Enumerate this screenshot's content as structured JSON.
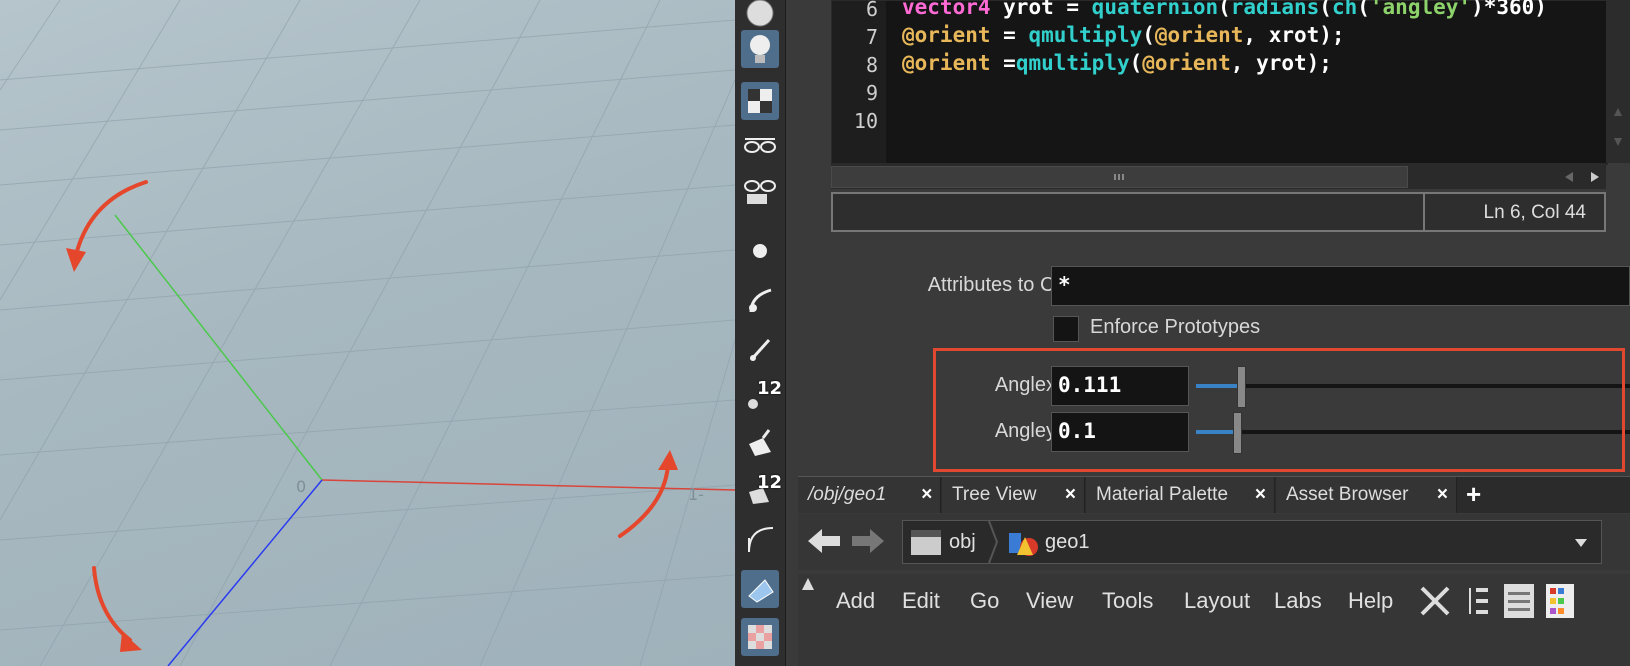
{
  "code": {
    "line_numbers": [
      "6",
      "7",
      "8",
      "9",
      "10"
    ],
    "lines": [
      [
        {
          "t": "vector4",
          "c": "kw-type"
        },
        {
          "t": " yrot = ",
          "c": "kw-plain"
        },
        {
          "t": "quaternion",
          "c": "kw-fn"
        },
        {
          "t": "(",
          "c": "kw-plain"
        },
        {
          "t": "radians",
          "c": "kw-fn"
        },
        {
          "t": "(",
          "c": "kw-plain"
        },
        {
          "t": "ch",
          "c": "kw-fn"
        },
        {
          "t": "(",
          "c": "kw-plain"
        },
        {
          "t": "'angley'",
          "c": "kw-str"
        },
        {
          "t": ")*360)",
          "c": "kw-plain"
        }
      ],
      [
        {
          "t": "@orient",
          "c": "kw-var"
        },
        {
          "t": " = ",
          "c": "kw-plain"
        },
        {
          "t": "qmultiply",
          "c": "kw-fn"
        },
        {
          "t": "(",
          "c": "kw-plain"
        },
        {
          "t": "@orient",
          "c": "kw-var"
        },
        {
          "t": ", xrot);",
          "c": "kw-plain"
        }
      ],
      [
        {
          "t": "@orient",
          "c": "kw-var"
        },
        {
          "t": " =",
          "c": "kw-plain"
        },
        {
          "t": "qmultiply",
          "c": "kw-fn"
        },
        {
          "t": "(",
          "c": "kw-plain"
        },
        {
          "t": "@orient",
          "c": "kw-var"
        },
        {
          "t": ", yrot);",
          "c": "kw-plain"
        }
      ],
      [],
      []
    ]
  },
  "status": {
    "message": "",
    "position": "Ln 6, Col 44"
  },
  "params": {
    "attributes_label": "Attributes to Create",
    "attributes_value": "*",
    "enforce_label": "Enforce Prototypes",
    "anglex_label": "Anglex",
    "anglex_value": "0.111",
    "angley_label": "Angley",
    "angley_value": "0.1"
  },
  "shelf": {
    "badge1": "12",
    "badge2": "12"
  },
  "tabs": [
    {
      "label": "/obj/geo1"
    },
    {
      "label": "Tree View"
    },
    {
      "label": "Material Palette"
    },
    {
      "label": "Asset Browser"
    }
  ],
  "tab_close_glyph": "×",
  "add_tab_glyph": "+",
  "path": {
    "root": "obj",
    "node": "geo1"
  },
  "menu": [
    "Add",
    "Edit",
    "Go",
    "View",
    "Tools",
    "Layout",
    "Labs",
    "Help"
  ],
  "colors": {
    "accent": "#4f6e8c",
    "highlight_box": "#e0482f",
    "slider_fill": "#3a82c6",
    "arrow_red": "#e5472c"
  },
  "viewport_labels": [
    "0",
    "1-"
  ]
}
